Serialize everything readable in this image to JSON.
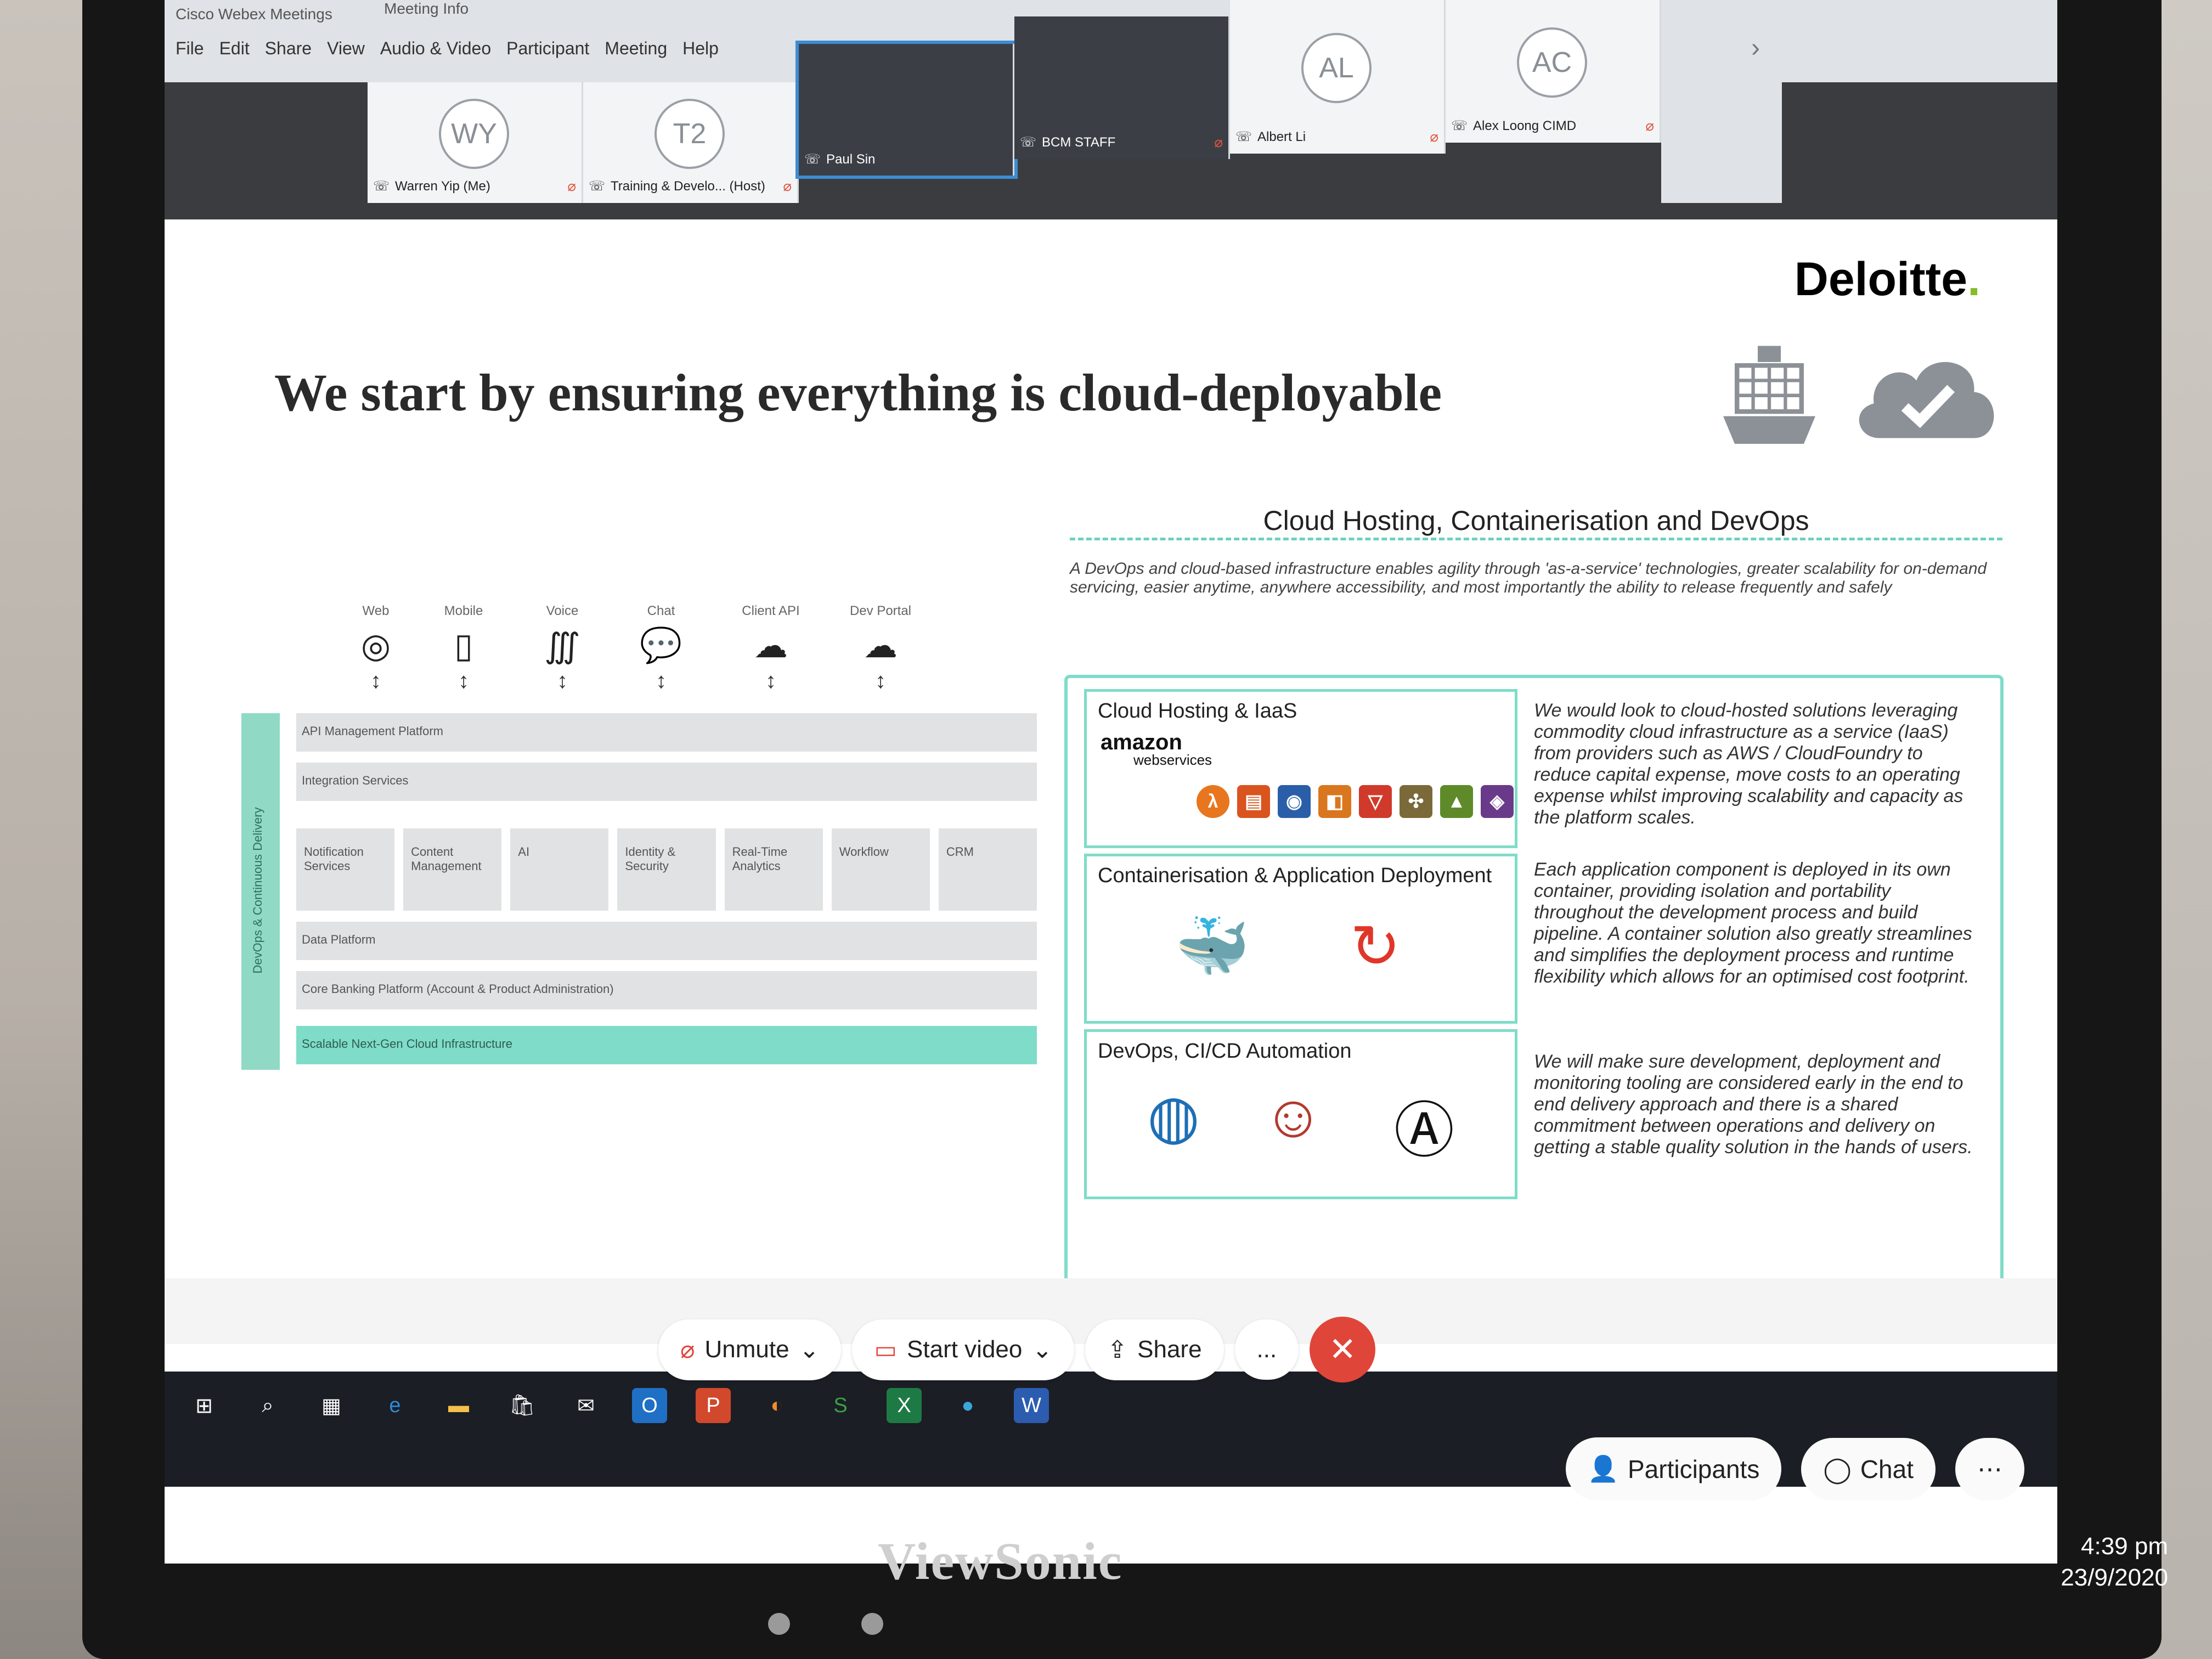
{
  "window": {
    "app_title": "Cisco Webex Meetings",
    "meeting_info": "Meeting Info",
    "menu": [
      "File",
      "Edit",
      "Share",
      "View",
      "Audio & Video",
      "Participant",
      "Meeting",
      "Help"
    ]
  },
  "participants": [
    {
      "initials": "WY",
      "name": "Warren Yip (Me)",
      "type": "avatar"
    },
    {
      "initials": "T2",
      "name": "Training & Develo... (Host)",
      "type": "avatar"
    },
    {
      "initials": "",
      "name": "Paul Sin",
      "type": "video"
    },
    {
      "initials": "",
      "name": "BCM STAFF",
      "type": "video"
    },
    {
      "initials": "AL",
      "name": "Albert Li",
      "type": "avatar"
    },
    {
      "initials": "AC",
      "name": "Alex Loong CIMD",
      "type": "avatar"
    }
  ],
  "slide": {
    "logo": "Deloitte",
    "headline": "We start by ensuring everything is cloud-deployable",
    "section_title": "Cloud Hosting, Containerisation and DevOps",
    "intro": "A DevOps and cloud-based infrastructure enables agility through 'as-a-service' technologies, greater scalability for on-demand servicing, easier anytime, anywhere accessibility, and most importantly the ability to release frequently and safely",
    "channels": [
      "Web",
      "Mobile",
      "Voice",
      "Chat",
      "Client API",
      "Dev Portal"
    ],
    "side_label": "DevOps & Continuous Delivery",
    "layers": {
      "api": "API Management Platform",
      "integration": "Integration Services",
      "components": [
        "Notification Services",
        "Content Management",
        "AI",
        "Identity & Security",
        "Real-Time Analytics",
        "Workflow",
        "CRM"
      ],
      "data": "Data Platform",
      "core": "Core Banking Platform (Account & Product Administration)",
      "infra": "Scalable Next-Gen Cloud Infrastructure"
    },
    "boxes": [
      {
        "title": "Cloud Hosting & IaaS",
        "text": "We would look to cloud-hosted solutions leveraging commodity cloud infrastructure as a service (IaaS) from providers such as AWS / CloudFoundry to reduce capital expense, move costs to an operating expense whilst improving scalability and capacity as the platform scales."
      },
      {
        "title": "Containerisation & Application Deployment",
        "text": "Each application component is deployed in its own container, providing isolation and portability throughout the development process and build pipeline. A container solution also greatly streamlines and simplifies the deployment process and runtime flexibility which allows for an optimised cost footprint."
      },
      {
        "title": "DevOps, CI/CD Automation",
        "text": "We will make sure development, deployment and monitoring tooling are considered early in the end to end delivery approach and there is a shared commitment between operations and delivery on getting a stable quality solution in the hands of users."
      }
    ],
    "aws_logo_1": "amazon",
    "aws_logo_2": "webservices"
  },
  "controls": {
    "unmute": "Unmute",
    "start_video": "Start video",
    "share": "Share",
    "more": "...",
    "participants": "Participants",
    "chat": "Chat"
  },
  "clock": {
    "time": "4:39 pm",
    "date": "23/9/2020"
  },
  "monitor_brand": "ViewSonic"
}
